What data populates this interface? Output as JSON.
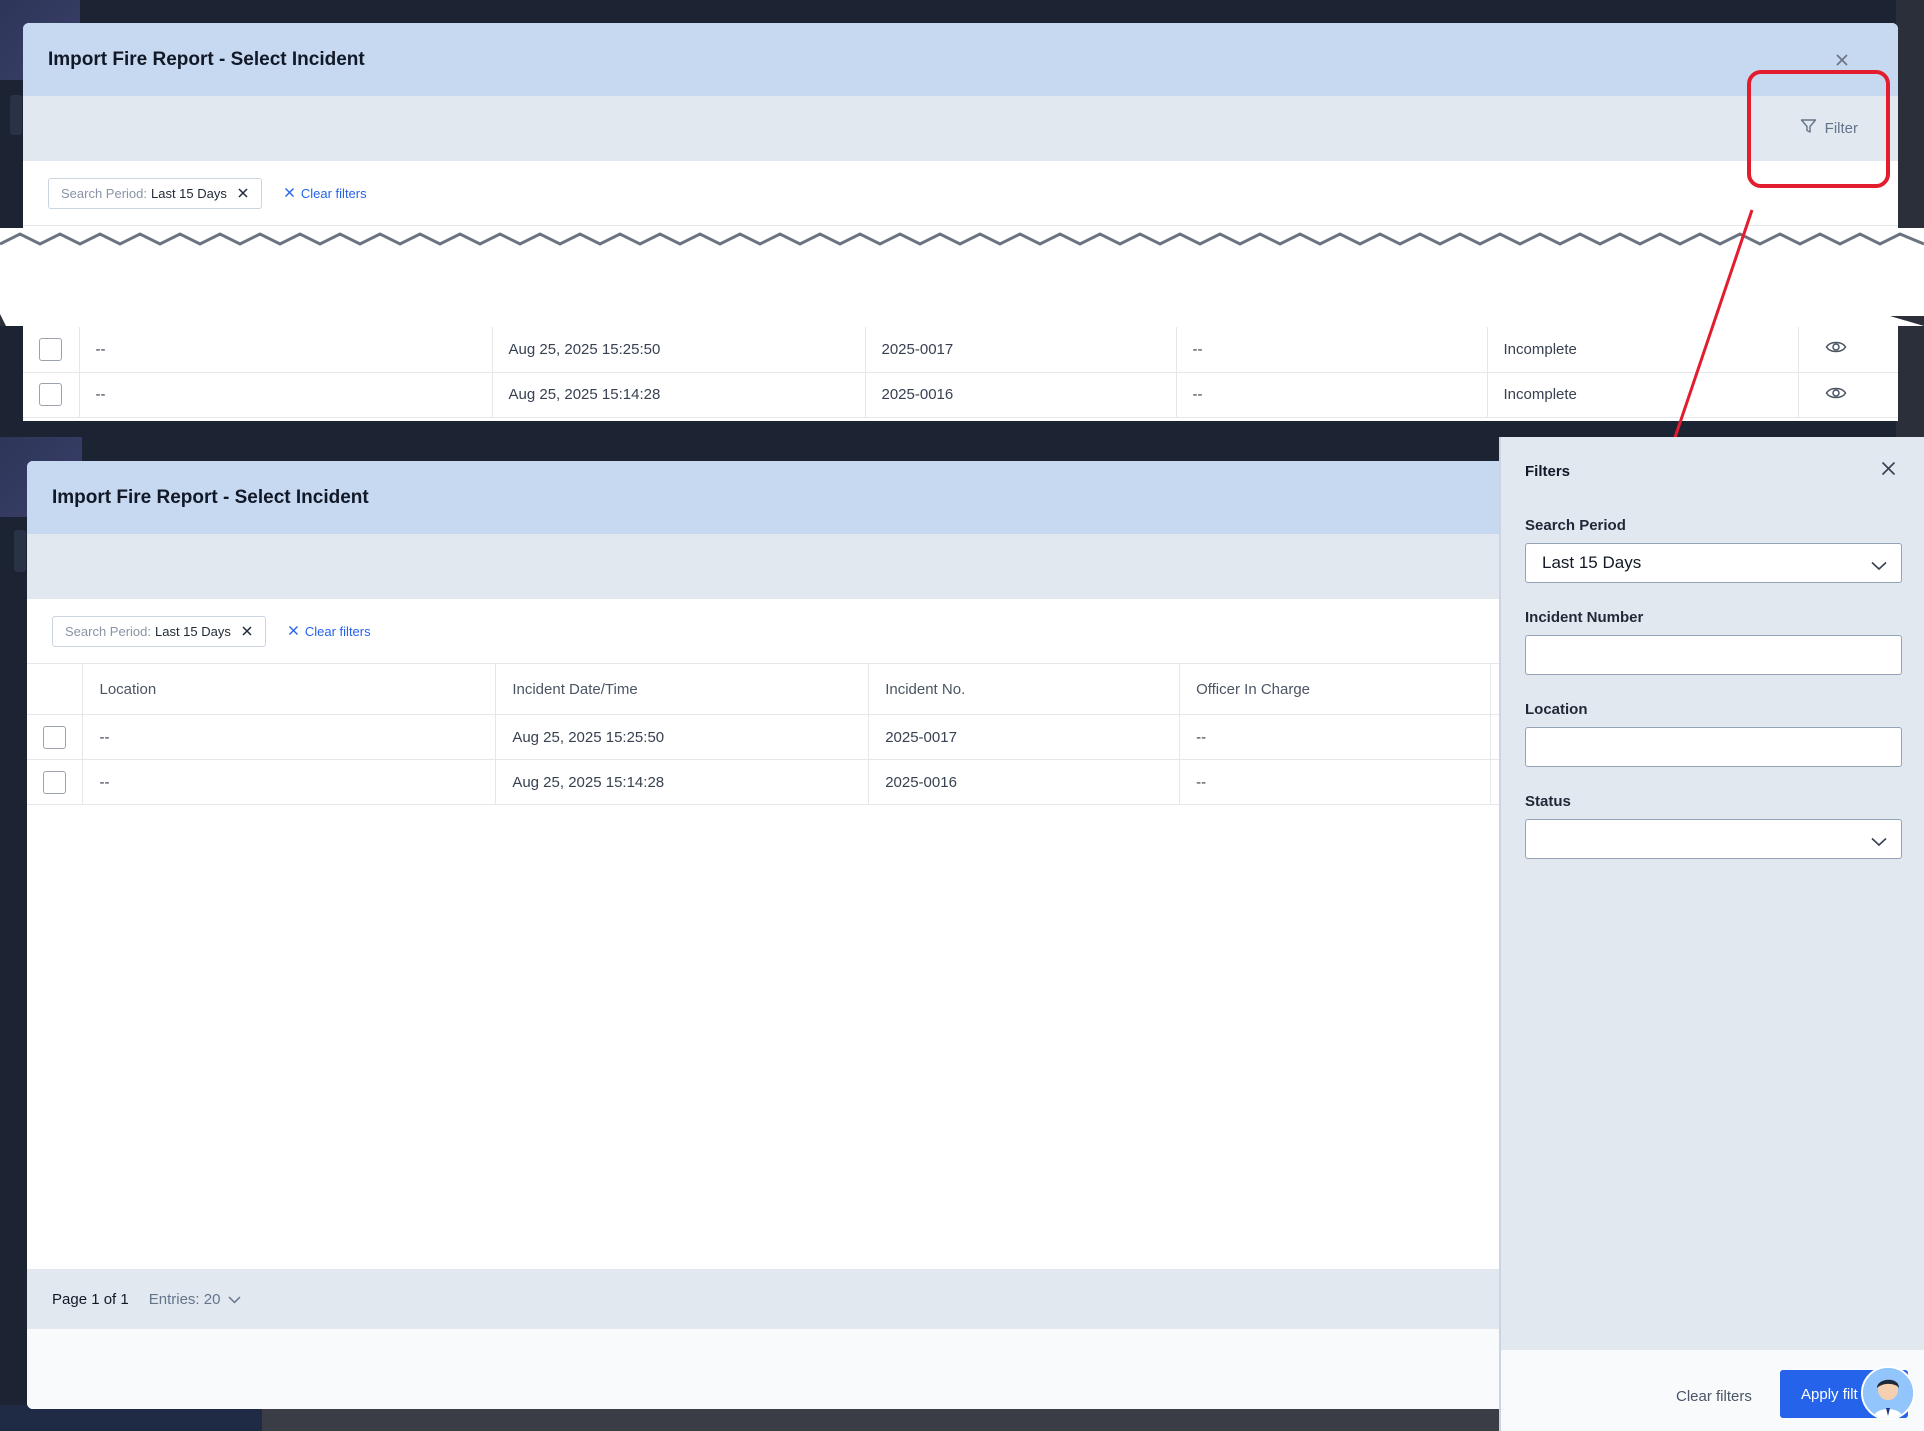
{
  "accent": "#2563eb",
  "header_bg": "#c7d9f1",
  "callout_color": "#e11d2e",
  "top_modal": {
    "title": "Import Fire Report - Select Incident",
    "filter_label": "Filter",
    "chip": {
      "label": "Search Period:",
      "value": "Last 15 Days"
    },
    "clear_filters": "Clear filters",
    "rows": [
      {
        "location": "--",
        "datetime": "Aug 25, 2025 15:25:50",
        "number": "2025-0017",
        "officer": "--",
        "status": "Incomplete"
      },
      {
        "location": "--",
        "datetime": "Aug 25, 2025 15:14:28",
        "number": "2025-0016",
        "officer": "--",
        "status": "Incomplete"
      }
    ]
  },
  "bottom_modal": {
    "title": "Import Fire Report - Select Incident",
    "chip": {
      "label": "Search Period:",
      "value": "Last 15 Days"
    },
    "clear_filters": "Clear filters",
    "columns": [
      "Location",
      "Incident Date/Time",
      "Incident No.",
      "Officer In Charge"
    ],
    "rows": [
      {
        "location": "--",
        "datetime": "Aug 25, 2025 15:25:50",
        "number": "2025-0017",
        "officer": "--"
      },
      {
        "location": "--",
        "datetime": "Aug 25, 2025 15:14:28",
        "number": "2025-0016",
        "officer": "--"
      }
    ],
    "pager": {
      "page": "Page 1 of 1",
      "entries": "Entries: 20"
    }
  },
  "drawer": {
    "title": "Filters",
    "search_period_label": "Search Period",
    "search_period_value": "Last 15 Days",
    "incident_number_label": "Incident Number",
    "incident_number_value": "",
    "location_label": "Location",
    "location_value": "",
    "status_label": "Status",
    "status_value": "",
    "clear_filters": "Clear filters",
    "apply": "Apply filt"
  }
}
